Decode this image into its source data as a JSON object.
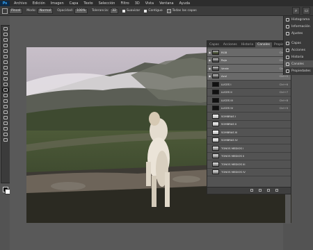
{
  "menubar": {
    "logo": "Ps",
    "items": [
      "Archivo",
      "Edición",
      "Imagen",
      "Capa",
      "Texto",
      "Selección",
      "Filtro",
      "3D",
      "Vista",
      "Ventana",
      "Ayuda"
    ]
  },
  "options": {
    "mode_preset": "Pincel",
    "mode_label": "Modo:",
    "mode_value": "Normal",
    "opacity_label": "Opacidad:",
    "opacity_value": "100%",
    "tolerance_label": "Tolerancia:",
    "tolerance_value": "32",
    "smooth_label": "Suavizar",
    "contiguous_label": "Contiguo",
    "all_layers_label": "Todas las capas"
  },
  "layers_panel": {
    "tabs": [
      "Capas",
      "Acciones",
      "Historia",
      "Canales",
      "Propiedades"
    ],
    "active_tab": "Canales",
    "rows": [
      {
        "name": "RGB",
        "shortcut": "Ctrl+2",
        "eye": true,
        "thumb": "photo",
        "selected": true
      },
      {
        "name": "Rojo",
        "shortcut": "Ctrl+3",
        "eye": true,
        "thumb": "gray",
        "selected": true
      },
      {
        "name": "Verde",
        "shortcut": "Ctrl+4",
        "eye": true,
        "thumb": "gray",
        "selected": true
      },
      {
        "name": "Azul",
        "shortcut": "Ctrl+5",
        "eye": true,
        "thumb": "gray",
        "selected": true
      },
      {
        "name": "LUCES I",
        "shortcut": "Ctrl+6",
        "eye": false,
        "thumb": "dark",
        "selected": false
      },
      {
        "name": "LUCES II",
        "shortcut": "Ctrl+7",
        "eye": false,
        "thumb": "dark",
        "selected": false
      },
      {
        "name": "LUCES III",
        "shortcut": "Ctrl+8",
        "eye": false,
        "thumb": "dark",
        "selected": false
      },
      {
        "name": "LUCES IV",
        "shortcut": "Ctrl+9",
        "eye": false,
        "thumb": "dark",
        "selected": false
      },
      {
        "name": "SOMBRAS I",
        "shortcut": "",
        "eye": false,
        "thumb": "light",
        "selected": false
      },
      {
        "name": "SOMBRAS II",
        "shortcut": "",
        "eye": false,
        "thumb": "light",
        "selected": false
      },
      {
        "name": "SOMBRAS III",
        "shortcut": "",
        "eye": false,
        "thumb": "light",
        "selected": false
      },
      {
        "name": "SOMBRAS IV",
        "shortcut": "",
        "eye": false,
        "thumb": "light",
        "selected": false
      },
      {
        "name": "TONOS MEDIOS I",
        "shortcut": "",
        "eye": false,
        "thumb": "mid",
        "selected": false
      },
      {
        "name": "TONOS MEDIOS II",
        "shortcut": "",
        "eye": false,
        "thumb": "mid",
        "selected": false
      },
      {
        "name": "TONOS MEDIOS III",
        "shortcut": "",
        "eye": false,
        "thumb": "mid",
        "selected": false
      },
      {
        "name": "TONOS MEDIOS IV",
        "shortcut": "",
        "eye": false,
        "thumb": "mid",
        "selected": false
      }
    ]
  },
  "right_dock": {
    "items": [
      {
        "label": "Histograma",
        "icon": "histogram-icon",
        "active": false
      },
      {
        "label": "Información",
        "icon": "info-icon",
        "active": false
      },
      {
        "label": "Ajustes",
        "icon": "adjustments-icon",
        "active": false
      },
      {
        "label": "Capas",
        "icon": "layers-icon",
        "active": false
      },
      {
        "label": "Acciones",
        "icon": "actions-icon",
        "active": false
      },
      {
        "label": "Historia",
        "icon": "history-icon",
        "active": false
      },
      {
        "label": "Canales",
        "icon": "channels-icon",
        "active": true
      },
      {
        "label": "Propiedades",
        "icon": "properties-icon",
        "active": false
      }
    ]
  },
  "colors": {
    "ui_bg": "#535353",
    "panel_dark": "#2d2d2d",
    "selected_row": "#6a6a6a",
    "foreground_color": "#000000",
    "background_color": "#ffffff"
  }
}
